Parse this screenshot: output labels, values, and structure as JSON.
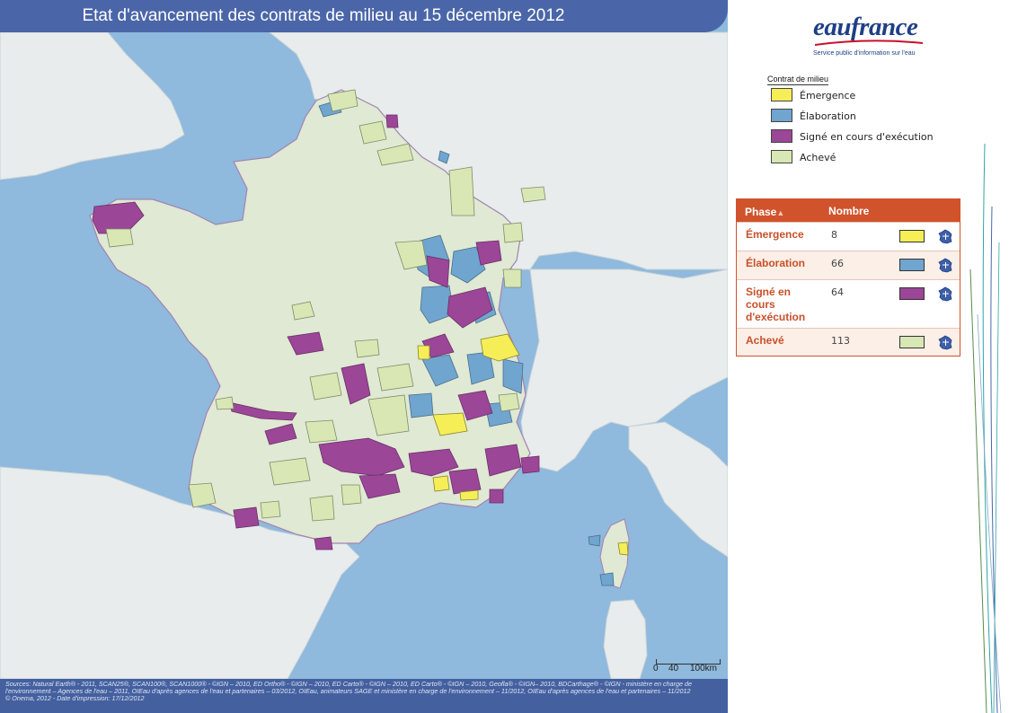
{
  "map": {
    "title": "Etat d'avancement des contrats de milieu au 15 décembre 2012",
    "sources": "Sources: Natural Earth® - 2011, SCAN25®, SCAN100®, SCAN1000® - ©IGN – 2010, ED Ortho® - ©IGN – 2010, ED Carto® - ©IGN – 2010, ED Carto® - ©IGN – 2010, Geofla® - ©IGN– 2010, BDCarthage® - ©IGN - ministère en charge de l'environnement – Agences de l'eau – 2011, OIEau d'après agences de l'eau et partenaires – 03/2012, OIEau, animateurs SAGE et ministère en charge de l'environnement – 11/2012, OIEau d'après agences de l'eau et partenaires – 11/2012",
    "credit": "© Onema, 2012 - Date d'impression: 17/12/2012",
    "scale": {
      "tick_0": "0",
      "tick_1": "40",
      "tick_2": "100km"
    },
    "colors": {
      "sea": "#8fb9dd",
      "land_france": "#dfe9d3",
      "land_other": "#e8ecec",
      "border": "#a383b3"
    }
  },
  "logo": {
    "name": "eaufrance",
    "tagline": "Service public d'information sur l'eau"
  },
  "legend": {
    "title": "Contrat de milieu",
    "items": [
      {
        "label": "Émergence",
        "color": "#f5ee57"
      },
      {
        "label": "Élaboration",
        "color": "#6fa5cf"
      },
      {
        "label": "Signé en cours d'exécution",
        "color": "#9b4697"
      },
      {
        "label": "Achevé",
        "color": "#d8e7b4"
      }
    ]
  },
  "stats": {
    "header_phase": "Phase",
    "header_nombre": "Nombre",
    "rows": [
      {
        "phase": "Émergence",
        "count": "8",
        "color": "#f5ee57"
      },
      {
        "phase": "Élaboration",
        "count": "66",
        "color": "#6fa5cf"
      },
      {
        "phase": "Signé en cours d'exécution",
        "count": "64",
        "color": "#9b4697"
      },
      {
        "phase": "Achevé",
        "count": "113",
        "color": "#d8e7b4"
      }
    ]
  }
}
